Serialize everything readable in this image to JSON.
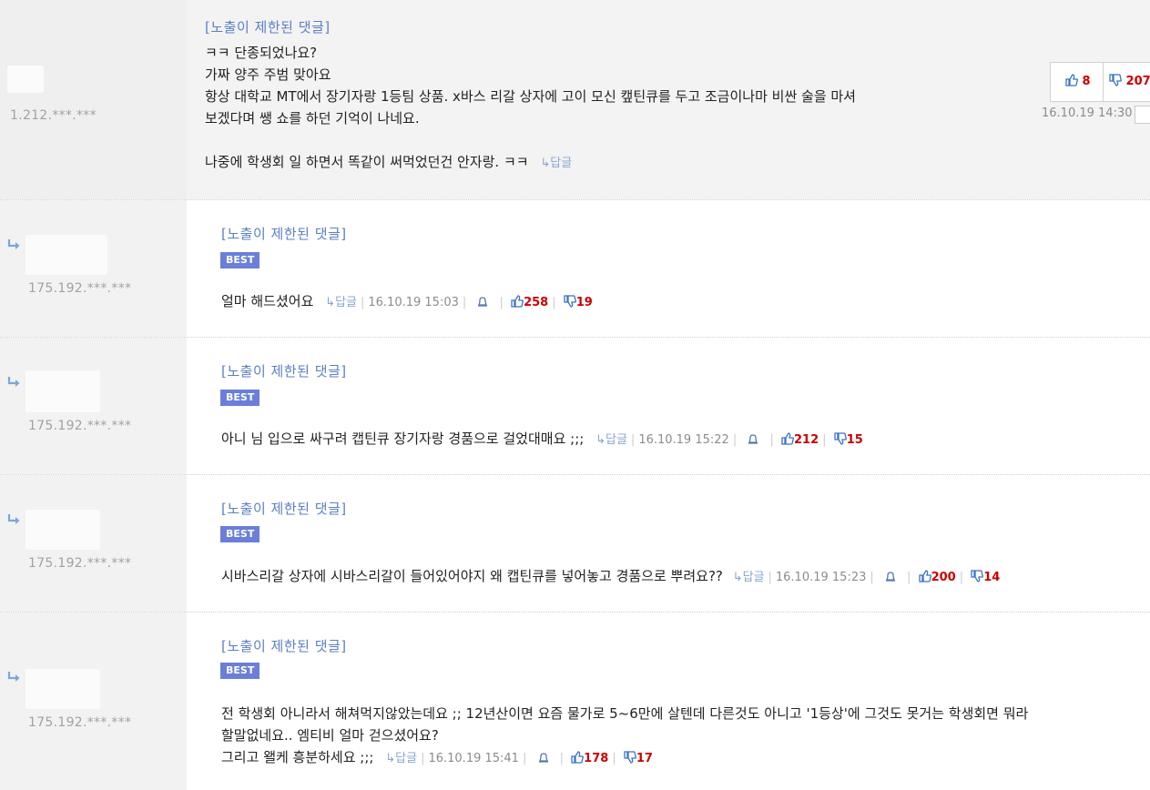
{
  "restricted_label": "[노출이 제한된 댓글]",
  "best_label": "BEST",
  "reply_label": "답글",
  "comments": [
    {
      "ip": "1.212.***.***",
      "lines": [
        "ㅋㅋ 단종되었나요?",
        "가짜 양주 주범 맞아요",
        "항상 대학교 MT에서 장기자랑 1등팀 상품. x바스 리갈 상자에 고이 모신 캪틴큐를 두고 조금이나마 비싼 술을 마셔",
        "보겠다며 쌩 쇼를 하던 기억이 나네요.",
        "",
        "나중에 학생회 일 하면서 똑같이 써먹었던건 안자랑. ㅋㅋ"
      ],
      "upvotes": "8",
      "downvotes": "207",
      "timestamp": "16.10.19 14:30"
    },
    {
      "ip": "175.192.***.***",
      "text": "얼마 해드셨어요",
      "timestamp": "16.10.19 15:03",
      "upvotes": "258",
      "downvotes": "19"
    },
    {
      "ip": "175.192.***.***",
      "text": "아니 님 입으로 싸구려 캡틴큐 장기자랑 경품으로 걸었대매요 ;;;",
      "timestamp": "16.10.19 15:22",
      "upvotes": "212",
      "downvotes": "15"
    },
    {
      "ip": "175.192.***.***",
      "text": "시바스리갈 상자에 시바스리갈이 들어있어야지 왜 캡틴큐를 넣어놓고 경품으로 뿌려요??",
      "timestamp": "16.10.19 15:23",
      "upvotes": "200",
      "downvotes": "14"
    },
    {
      "ip": "175.192.***.***",
      "lines": [
        "전 학생회 아니라서 해쳐먹지않았는데요 ;; 12년산이면 요즘 물가로 5~6만에 살텐데 다른것도 아니고 '1등상'에 그것도 못거는 학생회면 뭐라",
        "할말없네요.. 엠티비 얼마 걷으셨어요?"
      ],
      "last_line": "그리고 왤케 흥분하세요 ;;;",
      "timestamp": "16.10.19 15:41",
      "upvotes": "178",
      "downvotes": "17"
    }
  ],
  "colors": {
    "accent": "#5b7fc4",
    "best_bg": "#6b7fd8",
    "vote": "#cc0000",
    "reply_arrow": "#7aa6dc"
  },
  "icons": {
    "reply": "reply-arrow-icon",
    "up": "thumbs-up-icon",
    "down": "thumbs-down-icon",
    "report": "bell-icon"
  }
}
